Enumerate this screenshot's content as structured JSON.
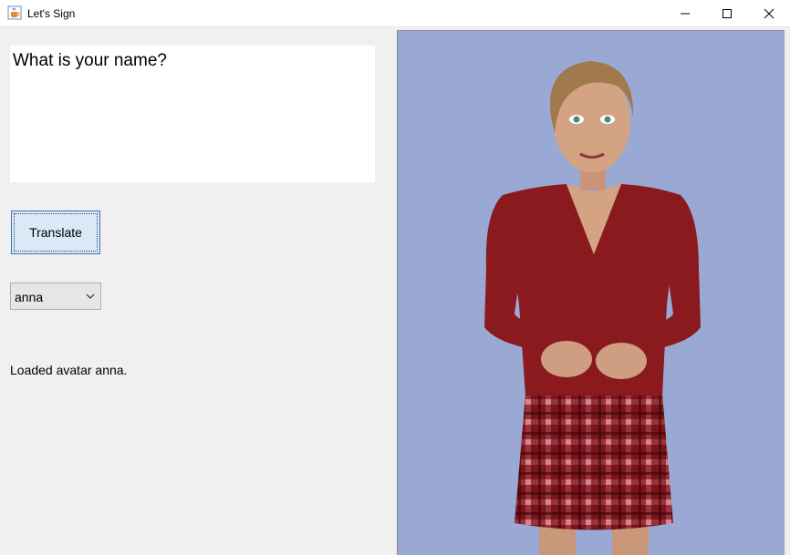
{
  "window": {
    "title": "Let's Sign",
    "icon": "java-coffee-cup-icon"
  },
  "controls": {
    "minimize_icon": "minimize-icon",
    "maximize_icon": "maximize-icon",
    "close_icon": "close-icon"
  },
  "input": {
    "text": "What is your name?"
  },
  "translate_button": {
    "label": "Translate"
  },
  "avatar_select": {
    "selected": "anna",
    "icon": "chevron-down-icon"
  },
  "status": {
    "text": "Loaded avatar anna."
  },
  "colors": {
    "avatar_background": "#9aa9d3",
    "button_fill": "#dbe9f7",
    "button_border": "#3b73ad",
    "sweater": "#8b1a1f",
    "skirt_plaid": "#6e0f14"
  }
}
